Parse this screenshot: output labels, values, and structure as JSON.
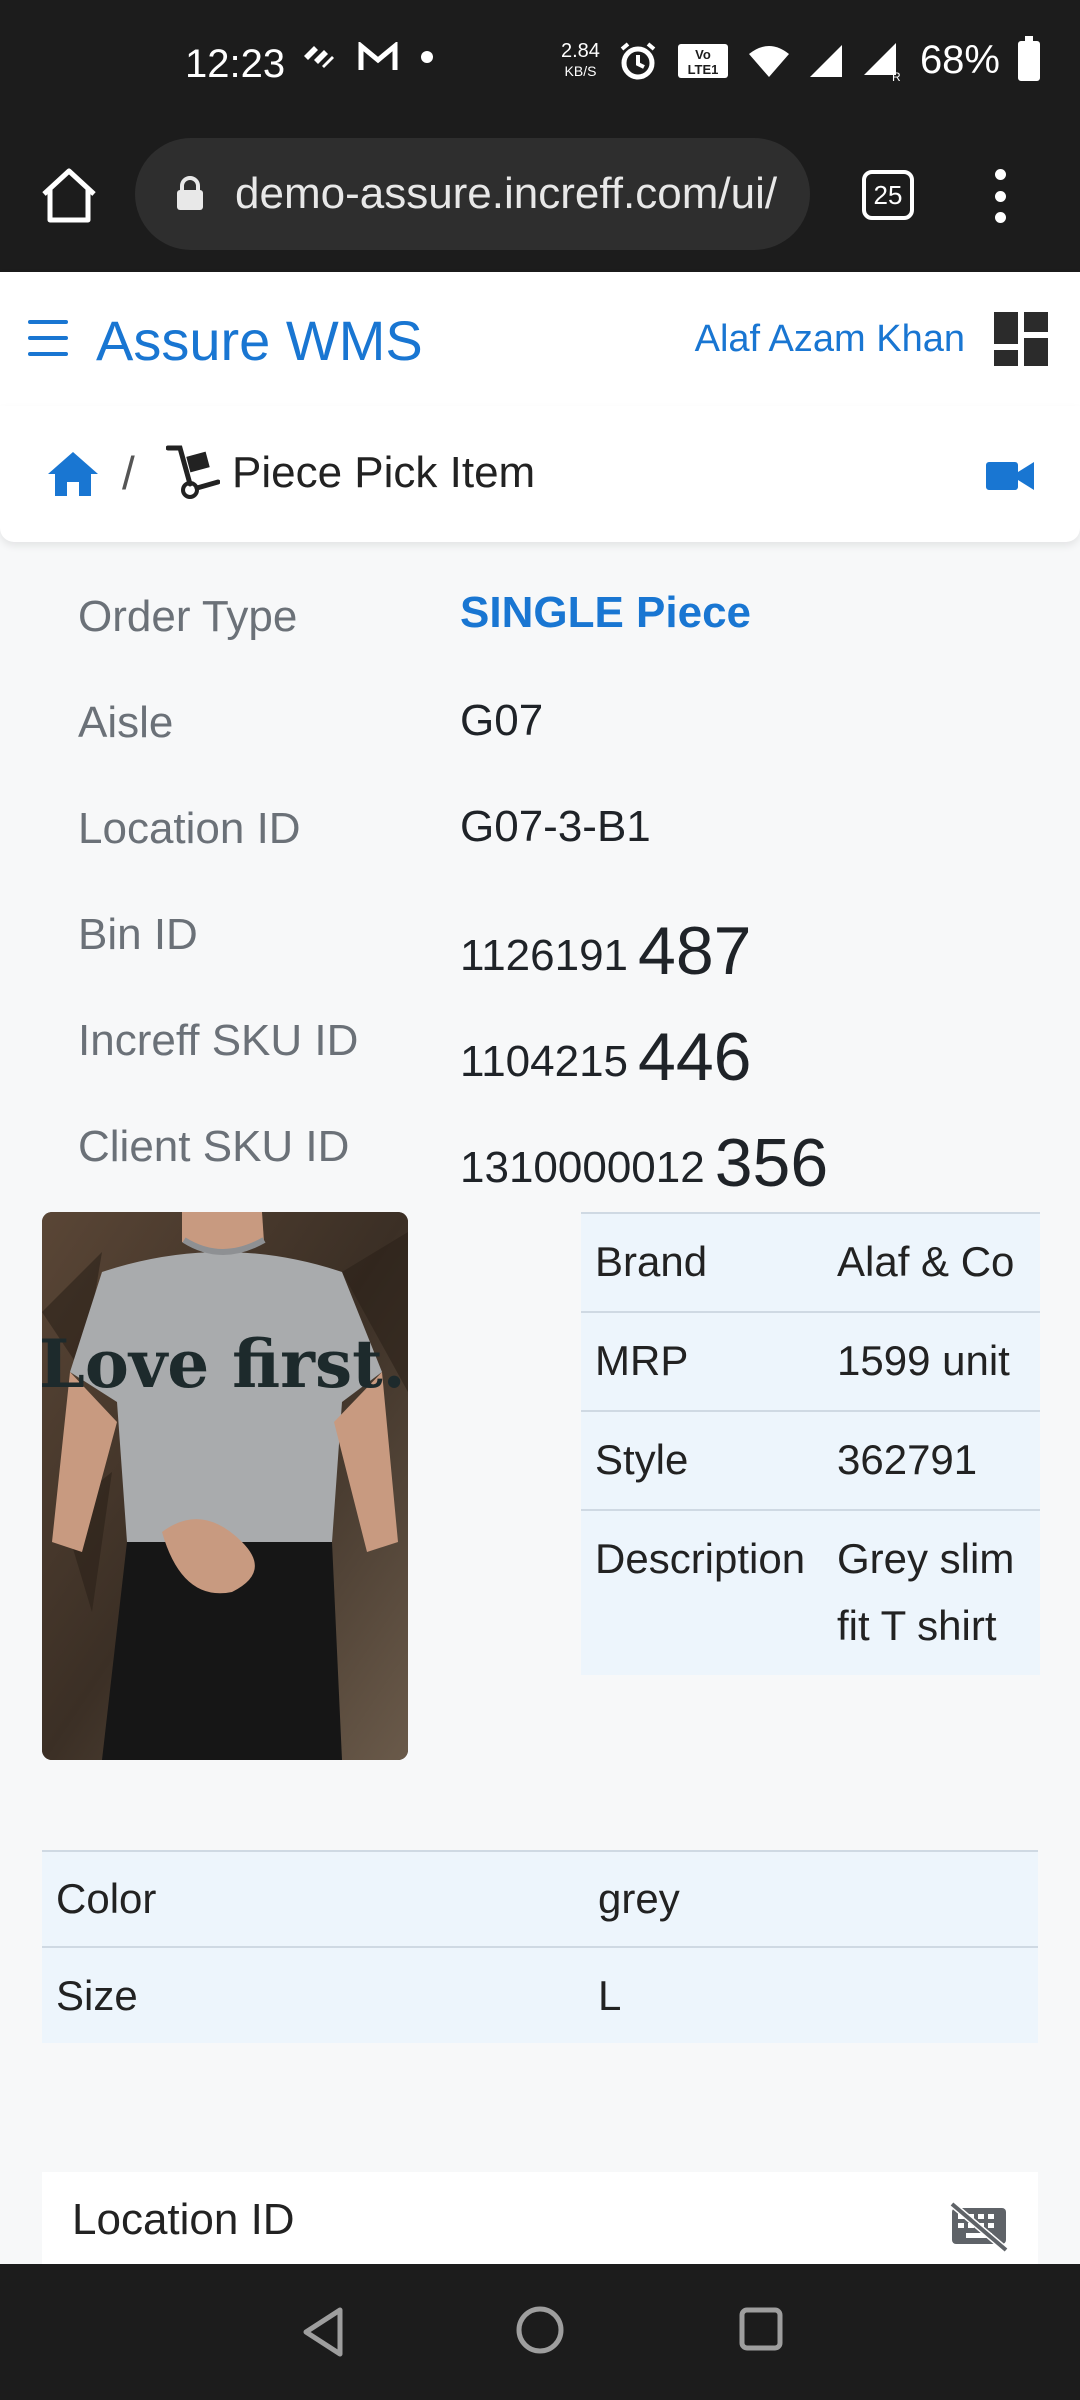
{
  "status_bar": {
    "time": "12:23",
    "net_speed": "2.84",
    "net_unit": "KB/S",
    "battery": "68%"
  },
  "browser": {
    "url": "demo-assure.increff.com/ui/",
    "tab_count": "25"
  },
  "app": {
    "title": "Assure WMS",
    "user_name": "Alaf Azam Khan",
    "accent_color": "#1976d2"
  },
  "breadcrumb": {
    "separator": "/",
    "page_title": "Piece Pick Item"
  },
  "details": {
    "order_type": {
      "label": "Order Type",
      "value": "SINGLE Piece"
    },
    "aisle": {
      "label": "Aisle",
      "value": "G07"
    },
    "location_id": {
      "label": "Location ID",
      "value": "G07-3-B1"
    },
    "bin_id": {
      "label": "Bin ID",
      "prefix": "1126191",
      "suffix": "487"
    },
    "increff_sku_id": {
      "label": "Increff SKU ID",
      "prefix": "1104215",
      "suffix": "446"
    },
    "client_sku_id": {
      "label": "Client SKU ID",
      "prefix": "1310000012",
      "suffix": "356"
    }
  },
  "product": {
    "shirt_print": "Love first.",
    "attributes": [
      {
        "key": "Brand",
        "value": "Alaf & Co"
      },
      {
        "key": "MRP",
        "value": "1599 unit"
      },
      {
        "key": "Style",
        "value": "362791"
      },
      {
        "key": "Description",
        "value": "Grey slim fit T shirt"
      }
    ],
    "color": {
      "key": "Color",
      "value": "grey"
    },
    "size": {
      "key": "Size",
      "value": "L"
    }
  },
  "location_input": {
    "placeholder": "Location ID",
    "value": ""
  }
}
